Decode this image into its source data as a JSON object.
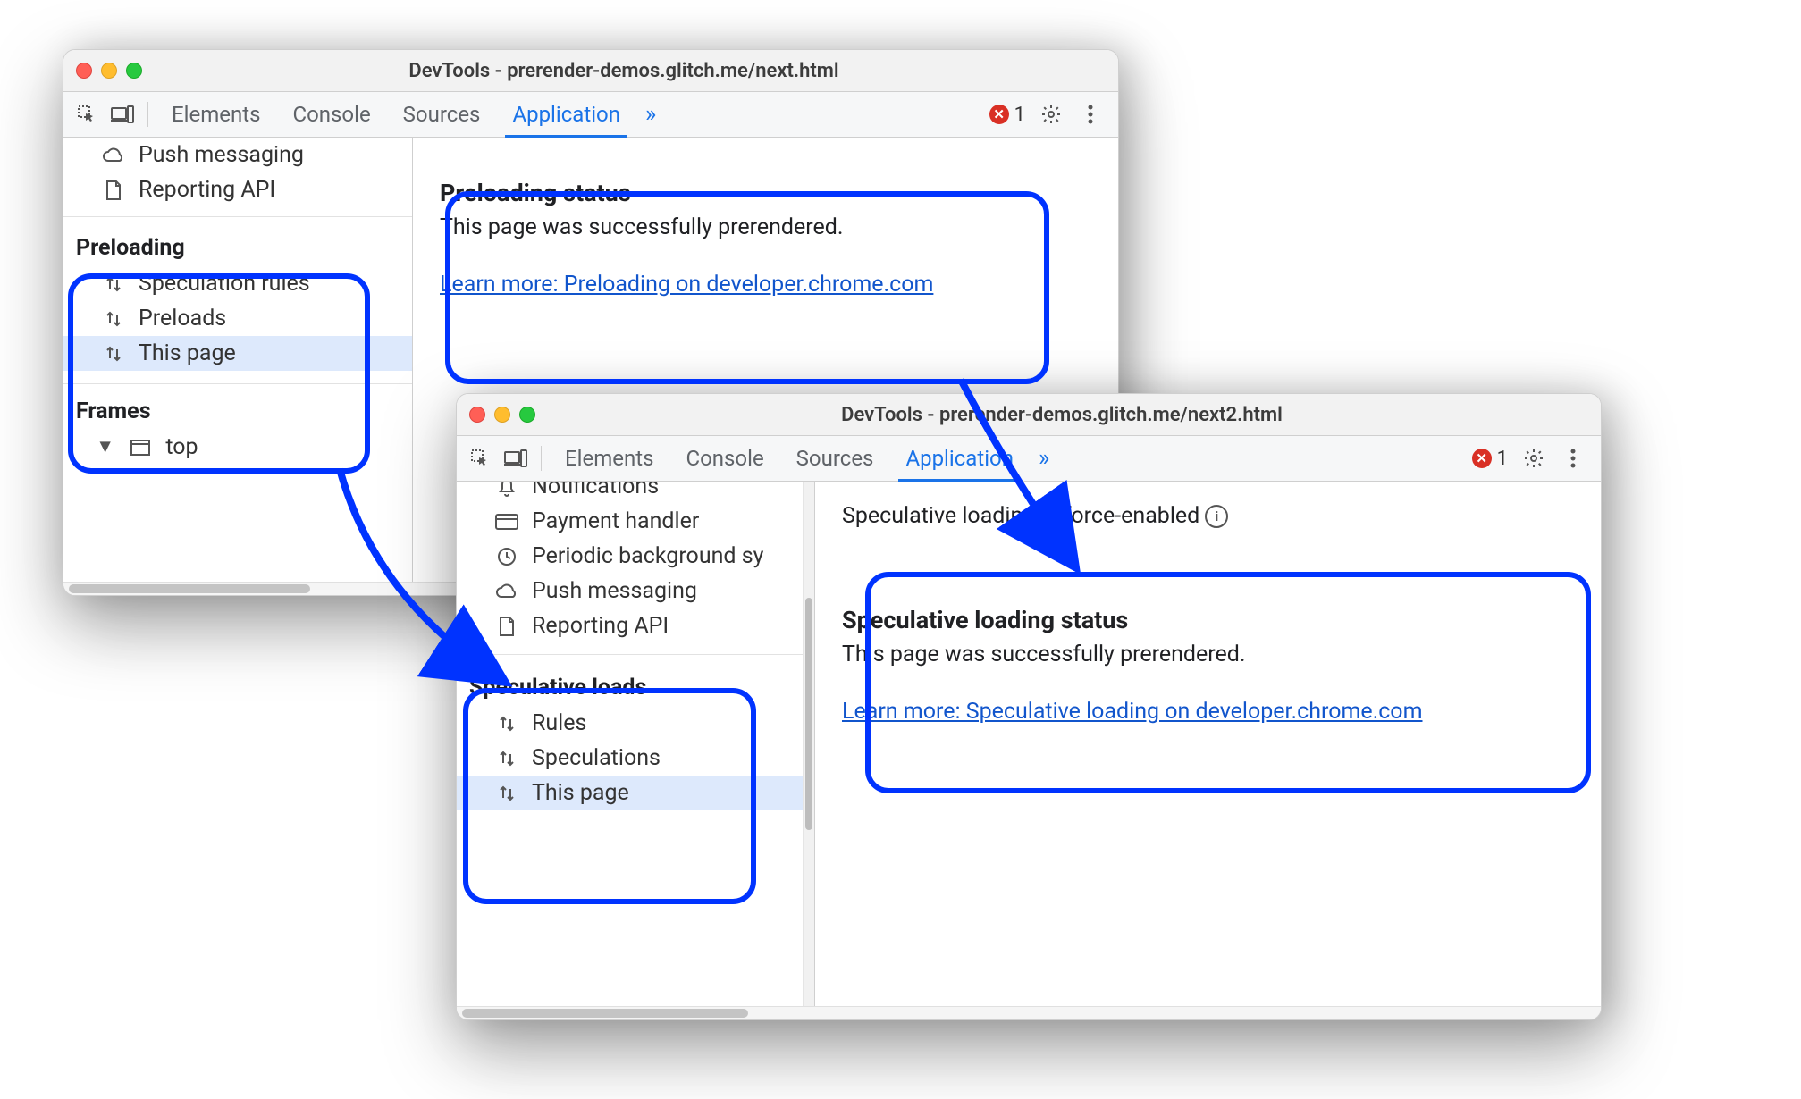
{
  "windows": {
    "a": {
      "title": "DevTools - prerender-demos.glitch.me/next.html",
      "tabs": [
        "Elements",
        "Console",
        "Sources",
        "Application"
      ],
      "activeTab": "Application",
      "errorCount": "1",
      "sidebar": {
        "topItems": [
          "Push messaging",
          "Reporting API"
        ],
        "sectionTitle": "Preloading",
        "sectionItems": [
          "Speculation rules",
          "Preloads",
          "This page"
        ],
        "framesTitle": "Frames",
        "framesItem": "top"
      },
      "content": {
        "title": "Preloading status",
        "body": "This page was successfully prerendered.",
        "linkText": "Learn more: Preloading on developer.chrome.com"
      }
    },
    "b": {
      "title": "DevTools - prerender-demos.glitch.me/next2.html",
      "tabs": [
        "Elements",
        "Console",
        "Sources",
        "Application"
      ],
      "activeTab": "Application",
      "errorCount": "1",
      "topBanner": "Speculative loading is force-enabled",
      "sidebar": {
        "topItems": [
          "Notifications",
          "Payment handler",
          "Periodic background sy",
          "Push messaging",
          "Reporting API"
        ],
        "sectionTitle": "Speculative loads",
        "sectionItems": [
          "Rules",
          "Speculations",
          "This page"
        ]
      },
      "content": {
        "title": "Speculative loading status",
        "body": "This page was successfully prerendered.",
        "linkText": "Learn more: Speculative loading on developer.chrome.com"
      }
    }
  }
}
